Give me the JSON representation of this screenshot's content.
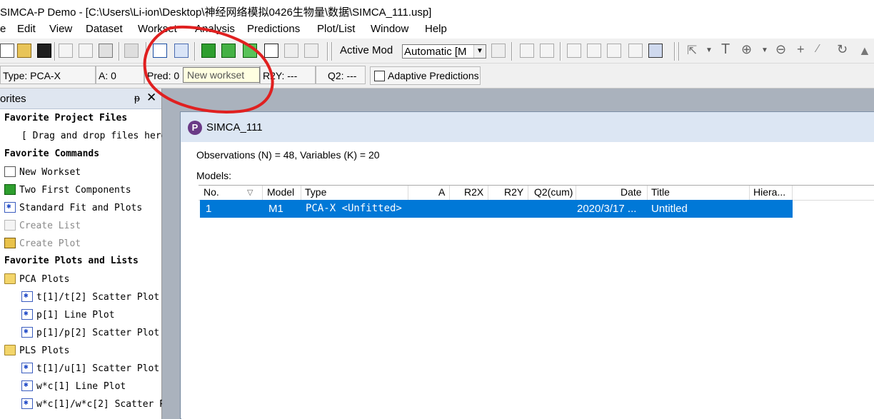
{
  "window": {
    "title": "SIMCA-P Demo - [C:\\Users\\Li-ion\\Desktop\\神经网络模拟0426生物量\\数据\\SIMCA_111.usp]"
  },
  "menu": {
    "file": "e",
    "edit": "Edit",
    "view": "View",
    "dataset": "Dataset",
    "workset": "Workset",
    "analysis": "Analysis",
    "predictions": "Predictions",
    "plotlist": "Plot/List",
    "window": "Window",
    "help": "Help"
  },
  "toolbar": {
    "active_model_label": "Active Mod",
    "active_model_value": "Automatic [M"
  },
  "statusbar": {
    "type": "Type: PCA-X",
    "a": "A: 0",
    "pred": "Pred: 0",
    "r2y": "R2Y: ---",
    "q2": "Q2: ---",
    "adaptive": "Adaptive Predictions"
  },
  "tooltip": {
    "text": "New workset"
  },
  "favorites": {
    "title": "orites",
    "pin": "ᵽ",
    "close": "✕",
    "items": [
      {
        "label": "Favorite Project Files",
        "kind": "header"
      },
      {
        "label": "[ Drag and drop files here",
        "kind": "note"
      },
      {
        "label": "Favorite Commands",
        "kind": "header"
      },
      {
        "label": "New Workset",
        "kind": "command",
        "icon": "workset-icon"
      },
      {
        "label": "Two First Components",
        "kind": "command",
        "icon": "components-icon"
      },
      {
        "label": "Standard Fit and Plots",
        "kind": "command",
        "icon": "scatter-icon"
      },
      {
        "label": "Create List",
        "kind": "command-disabled",
        "icon": "list-icon"
      },
      {
        "label": "Create Plot",
        "kind": "command-disabled",
        "icon": "plot-icon"
      },
      {
        "label": "Favorite Plots and Lists",
        "kind": "header"
      },
      {
        "label": "PCA Plots",
        "kind": "folder",
        "icon": "folder-icon"
      },
      {
        "label": "t[1]/t[2] Scatter Plot",
        "kind": "plot",
        "icon": "scatter-icon"
      },
      {
        "label": "p[1] Line Plot",
        "kind": "plot",
        "icon": "scatter-icon"
      },
      {
        "label": "p[1]/p[2] Scatter Plot",
        "kind": "plot",
        "icon": "scatter-icon"
      },
      {
        "label": "PLS Plots",
        "kind": "folder",
        "icon": "folder-icon"
      },
      {
        "label": "t[1]/u[1] Scatter Plot",
        "kind": "plot",
        "icon": "scatter-icon"
      },
      {
        "label": "w*c[1] Line Plot",
        "kind": "plot",
        "icon": "scatter-icon"
      },
      {
        "label": "w*c[1]/w*c[2] Scatter P",
        "kind": "plot",
        "icon": "scatter-icon"
      }
    ]
  },
  "project": {
    "title": "SIMCA_111",
    "icon_letter": "P",
    "summary": "Observations (N) = 48, Variables (K) = 20",
    "models_label": "Models:",
    "columns": [
      "No.",
      "Model",
      "Type",
      "A",
      "R2X",
      "R2Y",
      "Q2(cum)",
      "Date",
      "Title",
      "Hiera..."
    ],
    "sort_indicator": "▽",
    "rows": [
      {
        "no": "1",
        "model": "M1",
        "type": "PCA-X <Unfitted>",
        "a": "",
        "r2x": "",
        "r2y": "",
        "q2": "",
        "date": "2020/3/17 ...",
        "title": "Untitled"
      }
    ]
  },
  "annotation": {
    "color": "#e02020"
  }
}
